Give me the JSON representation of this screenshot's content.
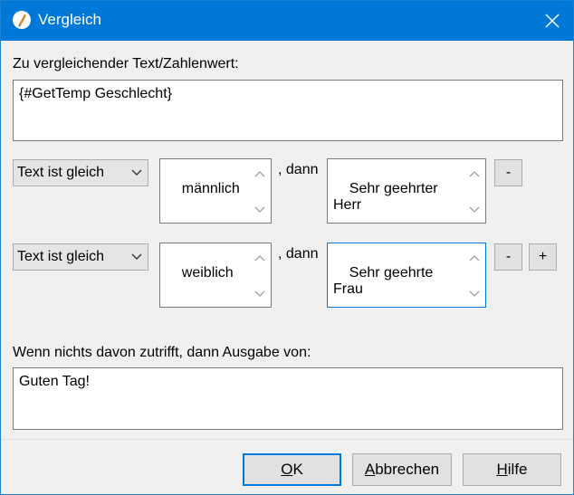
{
  "window": {
    "title": "Vergleich"
  },
  "compare": {
    "label": "Zu vergleichender Text/Zahlenwert:",
    "value": "{#GetTemp Geschlecht}"
  },
  "conditions": [
    {
      "operator": "Text ist gleich",
      "match": "männlich",
      "then_label": ", dann",
      "result": "Sehr geehrter Herr",
      "remove": "-"
    },
    {
      "operator": "Text ist gleich",
      "match": "weiblich",
      "then_label": ", dann",
      "result": "Sehr geehrte Frau",
      "remove": "-",
      "add": "+"
    }
  ],
  "fallback": {
    "label": "Wenn nichts davon zutrifft, dann Ausgabe von:",
    "value": "Guten Tag!"
  },
  "buttons": {
    "ok": {
      "mnemonic": "O",
      "rest": "K"
    },
    "cancel": {
      "mnemonic": "A",
      "rest": "bbrechen"
    },
    "help": {
      "mnemonic": "H",
      "rest": "ilfe"
    }
  },
  "colors": {
    "titlebar": "#0078d7",
    "focus": "#0078d7"
  }
}
